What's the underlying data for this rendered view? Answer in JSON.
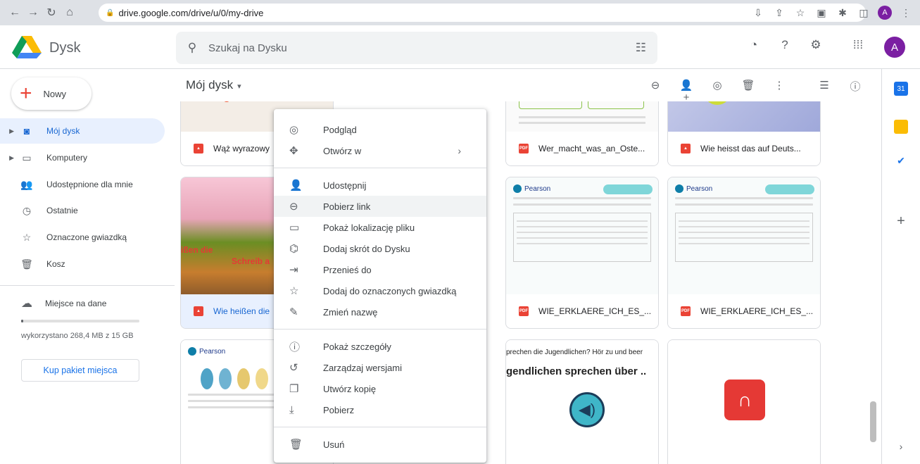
{
  "browser": {
    "url": "drive.google.com/drive/u/0/my-drive",
    "profile_initial": "A"
  },
  "app": {
    "title": "Dysk",
    "search_placeholder": "Szukaj na Dysku",
    "avatar_initial": "A"
  },
  "sidebar": {
    "new_label": "Nowy",
    "items": [
      {
        "label": "Mój dysk",
        "icon": "drive-icon",
        "active": true
      },
      {
        "label": "Komputery",
        "icon": "computer-icon"
      },
      {
        "label": "Udostępnione dla mnie",
        "icon": "shared-icon"
      },
      {
        "label": "Ostatnie",
        "icon": "clock-icon"
      },
      {
        "label": "Oznaczone gwiazdką",
        "icon": "star-icon"
      },
      {
        "label": "Kosz",
        "icon": "trash-icon"
      }
    ],
    "storage_label": "Miejsce na dane",
    "storage_used": "wykorzystano 268,4 MB z 15 GB",
    "storage_fraction": 0.018,
    "buy_label": "Kup pakiet miejsca"
  },
  "main": {
    "breadcrumb": "Mój dysk"
  },
  "files": [
    {
      "name": "Wąż wyrazowy",
      "type": "image"
    },
    {
      "name": "Wer_macht_was_an_Oste...",
      "type": "pdf"
    },
    {
      "name": "Wie heisst das auf Deuts...",
      "type": "image"
    },
    {
      "name": "Wie heißen die",
      "type": "image",
      "overlay1": "ißen die",
      "overlay2": "Schreib a"
    },
    {
      "name": "WIE_ERKLAERE_ICH_ES_...",
      "type": "pdf"
    },
    {
      "name": "WIE_ERKLAERE_ICH_ES_...",
      "type": "pdf"
    },
    {
      "name": "",
      "type": "pdf"
    },
    {
      "name": "",
      "type": "audio",
      "text1": "prechen die Jugendlichen? Hör zu und beer",
      "text2": "gendlichen sprechen über .."
    },
    {
      "name": "",
      "type": "audio"
    }
  ],
  "pearson_label": "Pearson",
  "context_menu": {
    "items": [
      {
        "label": "Podgląd",
        "icon": "eye-icon"
      },
      {
        "label": "Otwórz w",
        "icon": "open-with-icon",
        "submenu": true
      },
      {
        "label": "Udostępnij",
        "icon": "share-icon"
      },
      {
        "label": "Pobierz link",
        "icon": "link-icon",
        "hover": true
      },
      {
        "label": "Pokaż lokalizację pliku",
        "icon": "folder-icon"
      },
      {
        "label": "Dodaj skrót do Dysku",
        "icon": "shortcut-icon"
      },
      {
        "label": "Przenieś do",
        "icon": "move-icon"
      },
      {
        "label": "Dodaj do oznaczonych gwiazdką",
        "icon": "star-icon"
      },
      {
        "label": "Zmień nazwę",
        "icon": "pencil-icon"
      },
      {
        "label": "Pokaż szczegóły",
        "icon": "info-icon"
      },
      {
        "label": "Zarządzaj wersjami",
        "icon": "history-icon"
      },
      {
        "label": "Utwórz kopię",
        "icon": "copy-icon"
      },
      {
        "label": "Pobierz",
        "icon": "download-icon"
      },
      {
        "label": "Usuń",
        "icon": "trash-icon"
      }
    ]
  },
  "colors": {
    "accent": "#1a73e8",
    "active_bg": "#e8f0fe",
    "pdf_red": "#ea4335"
  }
}
